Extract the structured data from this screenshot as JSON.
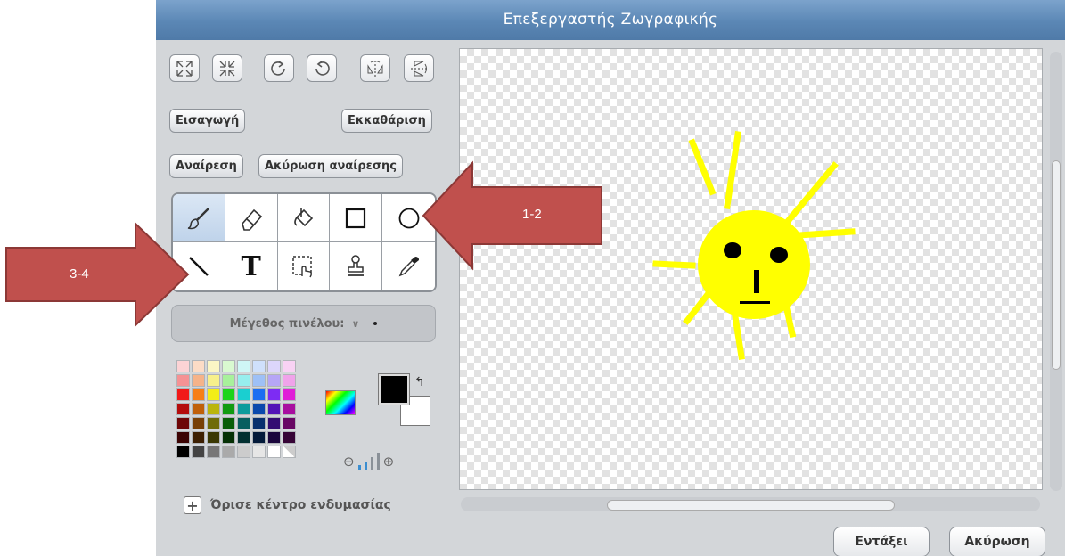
{
  "window": {
    "title": "Επεξεργαστής Ζωγραφικής"
  },
  "top_icons": [
    "enlarge-icon",
    "shrink-icon",
    "rotate-left-icon",
    "rotate-right-icon",
    "flip-horizontal-icon",
    "flip-vertical-icon"
  ],
  "buttons": {
    "import": "Εισαγωγή",
    "clear": "Εκκαθάριση",
    "undo": "Αναίρεση",
    "redo": "Ακύρωση αναίρεσης"
  },
  "tools": {
    "row1": [
      "paintbrush-icon",
      "eraser-icon",
      "fill-bucket-icon",
      "rectangle-icon",
      "ellipse-icon"
    ],
    "row2": [
      "line-icon",
      "text-tool",
      "select-icon",
      "stamp-icon",
      "eyedropper-icon"
    ],
    "text_glyph": "T",
    "selected": "paintbrush-icon"
  },
  "brush_size": {
    "label": "Μέγεθος πινέλου:",
    "chevron": "∨"
  },
  "palette": {
    "rows": [
      [
        "#fcd3d5",
        "#fcdcc6",
        "#fbf6c5",
        "#d9f9d0",
        "#cff6f6",
        "#cfe0fb",
        "#dcd6fb",
        "#f8d2f4"
      ],
      [
        "#f59294",
        "#f6b389",
        "#f7f08b",
        "#a8f19b",
        "#97eeee",
        "#9ec0f6",
        "#b6a6f6",
        "#f0a3ea"
      ],
      [
        "#f11919",
        "#f77f16",
        "#f3ee18",
        "#1dd41a",
        "#1acfd0",
        "#1c6ef2",
        "#7d2cf3",
        "#e01ed7"
      ],
      [
        "#b40c0c",
        "#c0600a",
        "#bab50b",
        "#119b10",
        "#0c9b9c",
        "#0a49ad",
        "#5315b7",
        "#a80fa0"
      ],
      [
        "#6e0707",
        "#784007",
        "#6f6c08",
        "#0a5e09",
        "#085e5f",
        "#08306e",
        "#330d72",
        "#680864"
      ],
      [
        "#3b0303",
        "#3d2003",
        "#3a3803",
        "#053005",
        "#033031",
        "#031a3a",
        "#1a063c",
        "#360436"
      ],
      [
        "#000000",
        "#444444",
        "#777777",
        "#aaaaaa",
        "#cccccc",
        "#e6e6e6",
        "#ffffff",
        "transparent"
      ]
    ]
  },
  "colors": {
    "foreground": "#000000",
    "background": "#ffffff",
    "accent": "#5b87b5"
  },
  "zoom": {
    "out_icon": "zoom-out-icon",
    "in_icon": "zoom-in-icon",
    "level": 2,
    "levels": 4
  },
  "set_center": {
    "label": "Όρισε κέντρο ενδυμασίας",
    "icon": "plus-icon"
  },
  "footer": {
    "ok": "Εντάξει",
    "cancel": "Ακύρωση"
  },
  "annotations": [
    {
      "label": "1-2",
      "points_to": "ellipse-tool"
    },
    {
      "label": "3-4",
      "points_to": "line-tool"
    }
  ],
  "canvas_drawing": "yellow sun with face"
}
